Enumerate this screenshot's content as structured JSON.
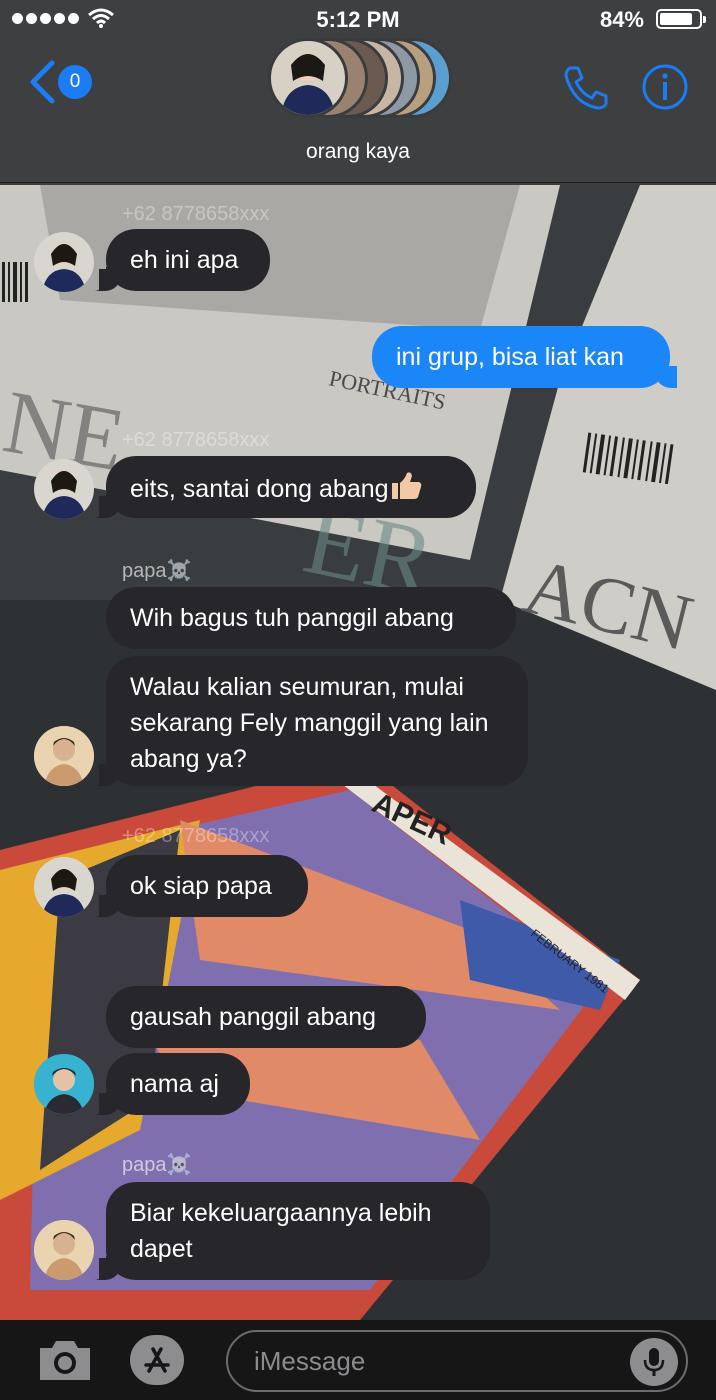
{
  "status_bar": {
    "time": "5:12 PM",
    "battery": "84%",
    "battery_level": 0.84
  },
  "header": {
    "back_badge": "0",
    "group_name": "orang kaya",
    "icons": [
      "chevron-left-icon",
      "phone-icon",
      "info-icon"
    ]
  },
  "background": {
    "phone_watermark": "+62 8778658xxx",
    "magazine_text": [
      "PORTRAITS",
      "ACN",
      "ER",
      "NE",
      "APER",
      "FEBRUARY 1981"
    ]
  },
  "messages": [
    {
      "id": 1,
      "text": "eh ini apa",
      "direction": "incoming"
    },
    {
      "id": 2,
      "text": "ini grup, bisa liat kan",
      "direction": "outgoing"
    },
    {
      "id": 3,
      "text": "eits, santai dong abang",
      "emoji": "👍🏻",
      "direction": "incoming"
    },
    {
      "id": 4,
      "sender": "papa",
      "sender_emoji": "☠️",
      "text": "Wih bagus tuh panggil abang",
      "direction": "incoming"
    },
    {
      "id": 5,
      "text": "Walau kalian seumuran, mulai sekarang Fely manggil yang lain abang ya?",
      "direction": "incoming"
    },
    {
      "id": 6,
      "text": "ok siap papa",
      "direction": "incoming"
    },
    {
      "id": 7,
      "text": "gausah panggil abang",
      "direction": "incoming"
    },
    {
      "id": 8,
      "text": "nama aj",
      "direction": "incoming"
    },
    {
      "id": 9,
      "sender": "papa",
      "sender_emoji": "☠️",
      "text": "Biar kekeluargaannya lebih dapet",
      "direction": "incoming"
    }
  ],
  "composer": {
    "placeholder": "iMessage",
    "icons": [
      "camera-icon",
      "app-store-icon",
      "microphone-icon"
    ]
  },
  "colors": {
    "outgoing_bubble": "#1b86f7",
    "incoming_bubble": "#26262b",
    "accent": "#1b7cf3"
  }
}
